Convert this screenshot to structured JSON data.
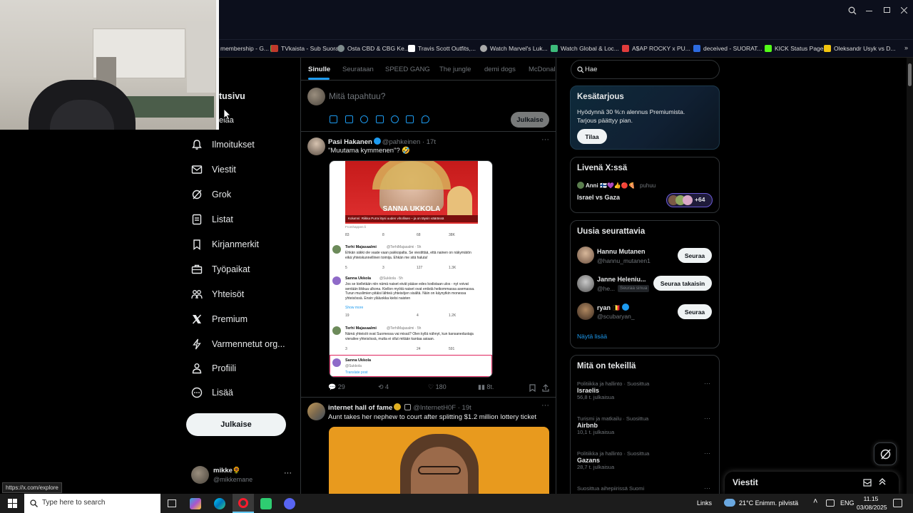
{
  "browser": {
    "bookmarks": [
      {
        "label": "membership - G...",
        "color": "#6ab04c"
      },
      {
        "label": "TVkaista - Sub Suora",
        "color": "#c0392b"
      },
      {
        "label": "Osta CBD & CBG Ke...",
        "color": "#7f8c8d"
      },
      {
        "label": "Travis Scott Outfits,...",
        "color": "#ffffff"
      },
      {
        "label": "Watch Marvel's Luk...",
        "color": "#aaaaaa"
      },
      {
        "label": "Watch Global & Loc...",
        "color": "#3dbb7b"
      },
      {
        "label": "A$AP ROCKY x PU...",
        "color": "#e03c3c"
      },
      {
        "label": "deceived - SUORAT...",
        "color": "#2d6be0"
      },
      {
        "label": "KICK Status Page",
        "color": "#53fc18"
      },
      {
        "label": "Oleksandr Usyk vs D...",
        "color": "#f1c40f"
      }
    ]
  },
  "nav": {
    "home_partial": "tusivu",
    "explore_partial": "elaa",
    "items": [
      {
        "label": "Ilmoitukset",
        "icon": "bell-icon"
      },
      {
        "label": "Viestit",
        "icon": "mail-icon"
      },
      {
        "label": "Grok",
        "icon": "grok-icon"
      },
      {
        "label": "Listat",
        "icon": "list-icon"
      },
      {
        "label": "Kirjanmerkit",
        "icon": "bookmark-icon"
      },
      {
        "label": "Työpaikat",
        "icon": "briefcase-icon"
      },
      {
        "label": "Yhteisöt",
        "icon": "people-icon"
      },
      {
        "label": "Premium",
        "icon": "x-logo-icon"
      },
      {
        "label": "Varmennetut org...",
        "icon": "bolt-icon"
      },
      {
        "label": "Profiili",
        "icon": "person-icon"
      },
      {
        "label": "Lisää",
        "icon": "more-circle-icon"
      }
    ],
    "post_button": "Julkaise",
    "account": {
      "name": "mikke🌻",
      "handle": "@mikkemane"
    },
    "status_url": "https://x.com/explore"
  },
  "feed": {
    "tabs": [
      "Sinulle",
      "Seurataan",
      "SPEED GANG",
      "The jungle",
      "demi dogs",
      "McDonal"
    ],
    "composer_placeholder": "Mitä tapahtuu?",
    "composer_post": "Julkaise",
    "tweet1": {
      "name": "Pasi Hakanen",
      "handle": "@pahkeinen",
      "time": "17t",
      "text": "\"Muutama kymmenen\"? 🤣",
      "replies": "29",
      "retweets": "4",
      "likes": "180",
      "views": "8t.",
      "embed": {
        "headline": "SANNA UKKOLA",
        "caption": "Kolumni: Riikka Purra löysi uuden vihollisen – ja on täysin väärässä",
        "replies": [
          {
            "name": "Terhi Majasaalmi",
            "handle": "@TerhiMajasalmi · 5h",
            "text": "Ehkän säkki ole vaate vaan pakkopalta. Se viestittää, että nainen on näkymätön eikä yhteiskunnellinen toimija. Ehkän me sitä haluta!"
          },
          {
            "name": "Sanna Ukkola",
            "handle": "@Sukkola · 5h",
            "text": "Jos se kielletään niin nämä naiset eivät pääse edes kodistaan ulos - nyt voivat sentään liikkua ulkona. Kiellon myötä naiset ovat entistä heikommassa asemassa. Turun muslimien pitäisi lähteä yhteisöjen sisältä. Näin on käynytkin monessa yhteisössä. Ensin yläluokka kielsi naisten"
          },
          {
            "name": "Terhi Majasaalmi",
            "handle": "@TerhiMajasalmi · 5h",
            "text": "Nämä yhteisöt ovat Suomessa vai missä? Olen kyllä nähnyt, kun kansanedustaja vierailee yhteisössä, mutta ei ollut mitään kantaa asiaan."
          },
          {
            "name": "Sanna Ukkola",
            "handle": "@Sukkola",
            "text": ""
          }
        ],
        "stats": [
          [
            "83",
            "8",
            "68",
            "38K"
          ],
          [
            "5",
            "3",
            "127",
            "1.3K"
          ],
          [
            "19",
            "",
            "4",
            "1.2K"
          ],
          [
            "3",
            "",
            "24",
            "591"
          ]
        ],
        "show_more": "Show more",
        "translate": "Translate post",
        "from": "Fromhappen:li"
      }
    },
    "tweet2": {
      "name": "internet hall of fame",
      "handle": "@InternetH0F",
      "time": "19t",
      "text": "Aunt takes her nephew to court after splitting $1.2 million lottery ticket"
    }
  },
  "right": {
    "search_value": "Hae",
    "premium": {
      "title": "Kesätarjous",
      "text": "Hyödynnä 30 %:n alennus Premiumista. Tarjous päättyy pian.",
      "button": "Tilaa"
    },
    "live": {
      "title": "Livenä X:ssä",
      "host": "Anni 🇫🇮💜👍🔴🍕",
      "status": "puhuu",
      "topic": "Israel vs Gaza",
      "count": "+64"
    },
    "follow": {
      "title": "Uusia seurattavia",
      "users": [
        {
          "name": "Hannu Mutanen",
          "handle": "@hannu_mutanen1",
          "button": "Seuraa",
          "badge": ""
        },
        {
          "name": "Janne Heleniu...",
          "handle": "@he...",
          "button": "Seuraa takaisin",
          "badge": "Seuraa sinua"
        },
        {
          "name": "ryan 🇧🇪",
          "handle": "@scubaryan_",
          "button": "Seuraa",
          "badge": ""
        }
      ],
      "more": "Näytä lisää"
    },
    "trends": {
      "title": "Mitä on tekeillä",
      "items": [
        {
          "cat": "Politiikka ja hallinto · Suosittua",
          "name": "Israelis",
          "count": "56,8 t. julkaisua"
        },
        {
          "cat": "Turismi ja matkailu · Suosittua",
          "name": "Airbnb",
          "count": "10,1 t. julkaisua"
        },
        {
          "cat": "Politiikka ja hallinto · Suosittua",
          "name": "Gazans",
          "count": "28,7 t. julkaisua"
        },
        {
          "cat": "Suosittua aihepiirissä Suomi",
          "name": "",
          "count": ""
        }
      ]
    },
    "messages": {
      "title": "Viestit"
    }
  },
  "taskbar": {
    "search_placeholder": "Type here to search",
    "links": "Links",
    "weather": "21°C  Enimm. pilvistä",
    "lang": "ENG",
    "time": "11.15",
    "date": "03/08/2025"
  }
}
